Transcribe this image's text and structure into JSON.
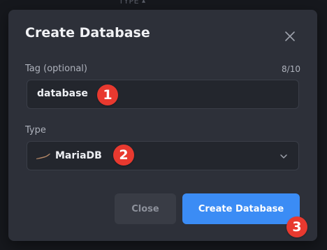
{
  "background": {
    "column_header": "TYPE",
    "column_header_icon": "caret-up-icon"
  },
  "dialog": {
    "title": "Create Database",
    "close_icon": "close-icon",
    "tag": {
      "label": "Tag (optional)",
      "counter": "8/10",
      "value": "database"
    },
    "type": {
      "label": "Type",
      "value": "MariaDB",
      "logo_icon": "mariadb-logo-icon",
      "chevron_icon": "chevron-down-icon"
    },
    "buttons": {
      "close_label": "Close",
      "create_label": "Create Database"
    }
  },
  "annotations": {
    "step1": "1",
    "step2": "2",
    "step3": "3"
  },
  "colors": {
    "accent": "#3b8cf5",
    "badge": "#e8392f",
    "modal_bg": "#2d3039",
    "input_bg": "#23262d"
  }
}
